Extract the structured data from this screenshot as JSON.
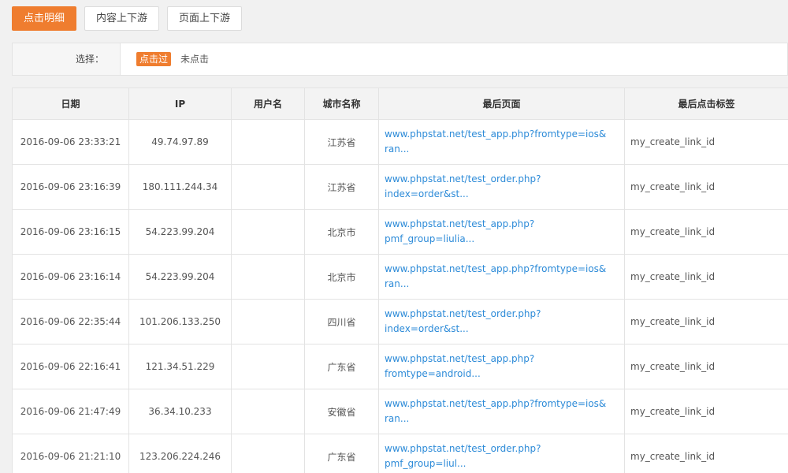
{
  "tabs": [
    {
      "label": "点击明细",
      "active": true
    },
    {
      "label": "内容上下游",
      "active": false
    },
    {
      "label": "页面上下游",
      "active": false
    }
  ],
  "filter": {
    "label": "选择：",
    "options": [
      "点击过",
      "未点击"
    ],
    "selected": "点击过"
  },
  "table": {
    "headers": [
      "日期",
      "IP",
      "用户名",
      "城市名称",
      "最后页面",
      "最后点击标签"
    ],
    "rows": [
      {
        "date": "2016-09-06 23:33:21",
        "ip": "49.74.97.89",
        "user": "",
        "city": "江苏省",
        "page": "www.phpstat.net/test_app.php?fromtype=ios&\nran...",
        "tag": "my_create_link_id"
      },
      {
        "date": "2016-09-06 23:16:39",
        "ip": "180.111.244.34",
        "user": "",
        "city": "江苏省",
        "page": "www.phpstat.net/test_order.php?index=order&st...",
        "tag": "my_create_link_id"
      },
      {
        "date": "2016-09-06 23:16:15",
        "ip": "54.223.99.204",
        "user": "",
        "city": "北京市",
        "page": "www.phpstat.net/test_app.php?pmf_group=liulia...",
        "tag": "my_create_link_id"
      },
      {
        "date": "2016-09-06 23:16:14",
        "ip": "54.223.99.204",
        "user": "",
        "city": "北京市",
        "page": "www.phpstat.net/test_app.php?fromtype=ios&\nran...",
        "tag": "my_create_link_id"
      },
      {
        "date": "2016-09-06 22:35:44",
        "ip": "101.206.133.250",
        "user": "",
        "city": "四川省",
        "page": "www.phpstat.net/test_order.php?index=order&st...",
        "tag": "my_create_link_id"
      },
      {
        "date": "2016-09-06 22:16:41",
        "ip": "121.34.51.229",
        "user": "",
        "city": "广东省",
        "page": "www.phpstat.net/test_app.php?fromtype=android...",
        "tag": "my_create_link_id"
      },
      {
        "date": "2016-09-06 21:47:49",
        "ip": "36.34.10.233",
        "user": "",
        "city": "安徽省",
        "page": "www.phpstat.net/test_app.php?fromtype=ios&\nran...",
        "tag": "my_create_link_id"
      },
      {
        "date": "2016-09-06 21:21:10",
        "ip": "123.206.224.246",
        "user": "",
        "city": "广东省",
        "page": "www.phpstat.net/test_order.php?pmf_group=liul...",
        "tag": "my_create_link_id"
      }
    ]
  },
  "colors": {
    "accent": "#ef7d2f",
    "link": "#2d8bd8"
  }
}
